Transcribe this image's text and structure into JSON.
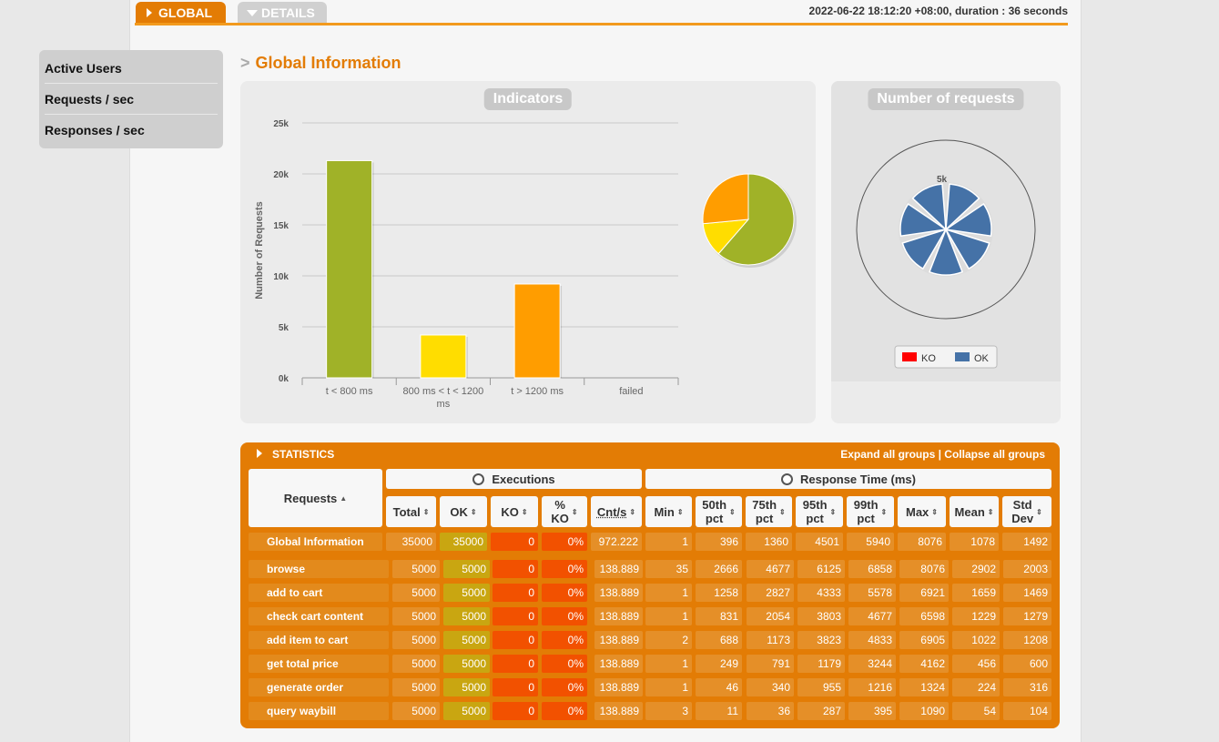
{
  "tabs": {
    "global": "GLOBAL",
    "details": "DETAILS"
  },
  "run_info": "2022-06-22 18:12:20 +08:00, duration : 36 seconds",
  "sidemenu": [
    "Active Users",
    "Requests / sec",
    "Responses / sec"
  ],
  "section_title": "Global Information",
  "section_title_prefix": ">",
  "indicators": {
    "title": "Indicators",
    "ylabel": "Number of Requests",
    "yticks": [
      "0k",
      "5k",
      "10k",
      "15k",
      "20k",
      "25k"
    ],
    "categories": [
      "t < 800 ms",
      "800 ms < t < 1200 ms",
      "t > 1200 ms",
      "failed"
    ],
    "category_lines": [
      [
        "t < 800 ms"
      ],
      [
        "800 ms < t < 1200",
        "ms"
      ],
      [
        "t > 1200 ms"
      ],
      [
        "failed"
      ]
    ]
  },
  "chart_data": [
    {
      "type": "bar",
      "title": "Indicators",
      "ylabel": "Number of Requests",
      "categories": [
        "t < 800 ms",
        "800 ms < t < 1200 ms",
        "t > 1200 ms",
        "failed"
      ],
      "values": [
        21300,
        4200,
        9200,
        0
      ],
      "colors": [
        "#a0b228",
        "#ffdd00",
        "#ff9d00",
        "#f15b4f"
      ],
      "ylim": [
        0,
        25000
      ]
    },
    {
      "type": "pie",
      "categories": [
        "t < 800 ms",
        "800 ms < t < 1200 ms",
        "t > 1200 ms"
      ],
      "values": [
        21300,
        4200,
        9200
      ],
      "colors": [
        "#a0b228",
        "#ffdd00",
        "#ff9d00"
      ]
    },
    {
      "type": "pie",
      "title": "Number of requests",
      "categories": [
        "browse",
        "add to cart",
        "check cart content",
        "add item to cart",
        "get total price",
        "generate order",
        "query waybill"
      ],
      "values": [
        5000,
        5000,
        5000,
        5000,
        5000,
        5000,
        5000
      ],
      "radial_label": "5k",
      "legend": [
        "KO",
        "OK"
      ],
      "legend_colors": [
        "#ff0000",
        "#4572a7"
      ],
      "legend_position": "bottom"
    }
  ],
  "requests_panel": {
    "title": "Number of requests",
    "radial_label": "5k",
    "legend_ko": "KO",
    "legend_ok": "OK"
  },
  "statistics": {
    "label": "STATISTICS",
    "expand": "Expand all groups",
    "separator": "|",
    "collapse": "Collapse all groups",
    "group_requests": "Requests",
    "group_executions": "Executions",
    "group_response": "Response Time (ms)",
    "columns": [
      [
        "Total"
      ],
      [
        "OK"
      ],
      [
        "KO"
      ],
      [
        "%",
        "KO"
      ],
      [
        "Cnt/s"
      ],
      [
        "Min"
      ],
      [
        "50th",
        "pct"
      ],
      [
        "75th",
        "pct"
      ],
      [
        "95th",
        "pct"
      ],
      [
        "99th",
        "pct"
      ],
      [
        "Max"
      ],
      [
        "Mean"
      ],
      [
        "Std",
        "Dev"
      ]
    ],
    "global_row": [
      "Global Information",
      "35000",
      "35000",
      "0",
      "0%",
      "972.222",
      "1",
      "396",
      "1360",
      "4501",
      "5940",
      "8076",
      "1078",
      "1492"
    ],
    "rows": [
      [
        "browse",
        "5000",
        "5000",
        "0",
        "0%",
        "138.889",
        "35",
        "2666",
        "4677",
        "6125",
        "6858",
        "8076",
        "2902",
        "2003"
      ],
      [
        "add to cart",
        "5000",
        "5000",
        "0",
        "0%",
        "138.889",
        "1",
        "1258",
        "2827",
        "4333",
        "5578",
        "6921",
        "1659",
        "1469"
      ],
      [
        "check cart content",
        "5000",
        "5000",
        "0",
        "0%",
        "138.889",
        "1",
        "831",
        "2054",
        "3803",
        "4677",
        "6598",
        "1229",
        "1279"
      ],
      [
        "add item to cart",
        "5000",
        "5000",
        "0",
        "0%",
        "138.889",
        "2",
        "688",
        "1173",
        "3823",
        "4833",
        "6905",
        "1022",
        "1208"
      ],
      [
        "get total price",
        "5000",
        "5000",
        "0",
        "0%",
        "138.889",
        "1",
        "249",
        "791",
        "1179",
        "3244",
        "4162",
        "456",
        "600"
      ],
      [
        "generate order",
        "5000",
        "5000",
        "0",
        "0%",
        "138.889",
        "1",
        "46",
        "340",
        "955",
        "1216",
        "1324",
        "224",
        "316"
      ],
      [
        "query waybill",
        "5000",
        "5000",
        "0",
        "0%",
        "138.889",
        "3",
        "11",
        "36",
        "287",
        "395",
        "1090",
        "54",
        "104"
      ]
    ]
  }
}
